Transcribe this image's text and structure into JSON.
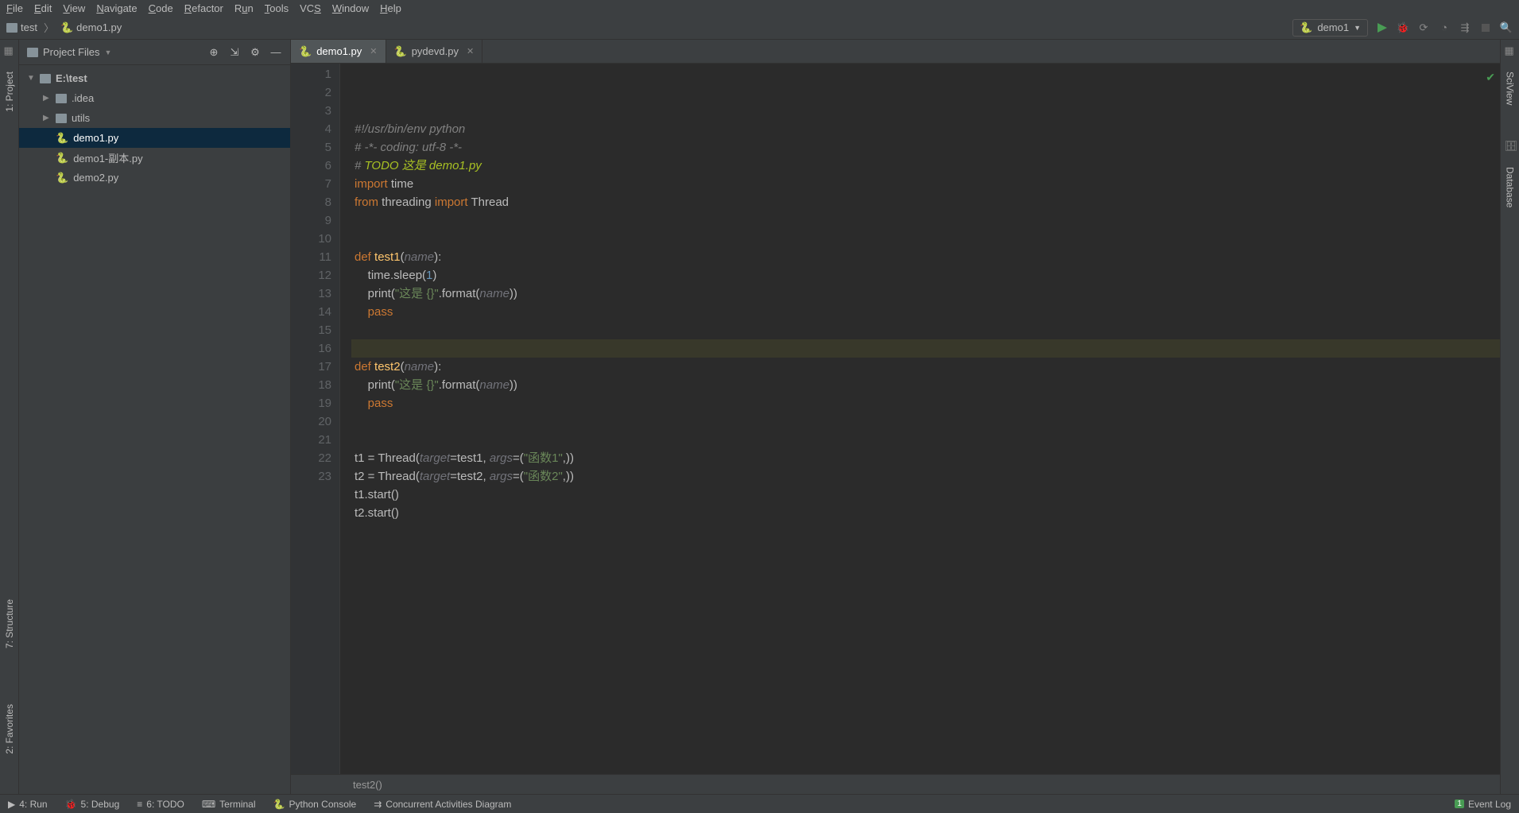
{
  "menu": {
    "items": [
      "File",
      "Edit",
      "View",
      "Navigate",
      "Code",
      "Refactor",
      "Run",
      "Tools",
      "VCS",
      "Window",
      "Help"
    ]
  },
  "breadcrumb": {
    "root": "test",
    "file": "demo1.py"
  },
  "run_config": {
    "name": "demo1"
  },
  "left_tabs": {
    "project": "1: Project",
    "structure": "7: Structure",
    "favorites": "2: Favorites"
  },
  "right_tabs": {
    "sciview": "SciView",
    "database": "Database"
  },
  "project_panel": {
    "title": "Project Files",
    "root": "E:\\test",
    "children": [
      {
        "name": ".idea",
        "type": "folder"
      },
      {
        "name": "utils",
        "type": "folder"
      },
      {
        "name": "demo1.py",
        "type": "py",
        "selected": true
      },
      {
        "name": "demo1-副本.py",
        "type": "py"
      },
      {
        "name": "demo2.py",
        "type": "py"
      }
    ]
  },
  "tabs": [
    {
      "label": "demo1.py",
      "active": true
    },
    {
      "label": "pydevd.py",
      "active": false
    }
  ],
  "editor": {
    "line_count": 23,
    "current_line": 16,
    "breadcrumb": "test2()",
    "raw_lines": [
      "#!/usr/bin/env python",
      "# -*- coding: utf-8 -*-",
      "# TODO 这是 demo1.py",
      "import time",
      "from threading import Thread",
      "",
      "",
      "def test1(name):",
      "    time.sleep(1)",
      "    print(\"这是 {}\".format(name))",
      "    pass",
      "",
      "",
      "def test2(name):",
      "    print(\"这是 {}\".format(name))",
      "    pass",
      "",
      "",
      "t1 = Thread(target=test1, args=(\"函数1\",))",
      "t2 = Thread(target=test2, args=(\"函数2\",))",
      "t1.start()",
      "t2.start()",
      ""
    ],
    "html_lines": [
      "<span class='comment'>#!/usr/bin/env python</span>",
      "<span class='comment'># -*- coding: utf-8 -*-</span>",
      "<span class='comment'># </span><span class='todo-comment'>TODO 这是 demo1.py</span>",
      "<span class='kw'>import</span> time",
      "<span class='kw'>from</span> threading <span class='kw'>import</span> Thread",
      "",
      "",
      "<span class='kw'>def</span> <span class='fn'>test1</span>(<span class='param'>name</span>):",
      "    time.sleep(<span class='num'>1</span>)",
      "    print(<span class='str'>\"这是 {}\"</span>.format(<span class='param'>name</span>))",
      "    <span class='kw'>pass</span>",
      "",
      "",
      "<span class='kw'>def</span> <span class='fn'>test2</span>(<span class='param'>name</span>):",
      "    print(<span class='str'>\"这是 {}\"</span>.format(<span class='param'>name</span>))",
      "    <span class='kw'>pass</span>",
      "",
      "",
      "t1 = Thread(<span class='param'>target</span>=test1, <span class='param'>args</span>=(<span class='str'>\"函数1\"</span>,))",
      "t2 = Thread(<span class='param'>target</span>=test2, <span class='param'>args</span>=(<span class='str'>\"函数2\"</span>,))",
      "t1.start()",
      "t2.start()",
      ""
    ]
  },
  "bottom": {
    "run": "4: Run",
    "debug": "5: Debug",
    "todo": "6: TODO",
    "terminal": "Terminal",
    "python_console": "Python Console",
    "concurrent": "Concurrent Activities Diagram",
    "event_log": "Event Log",
    "event_count": "1"
  }
}
